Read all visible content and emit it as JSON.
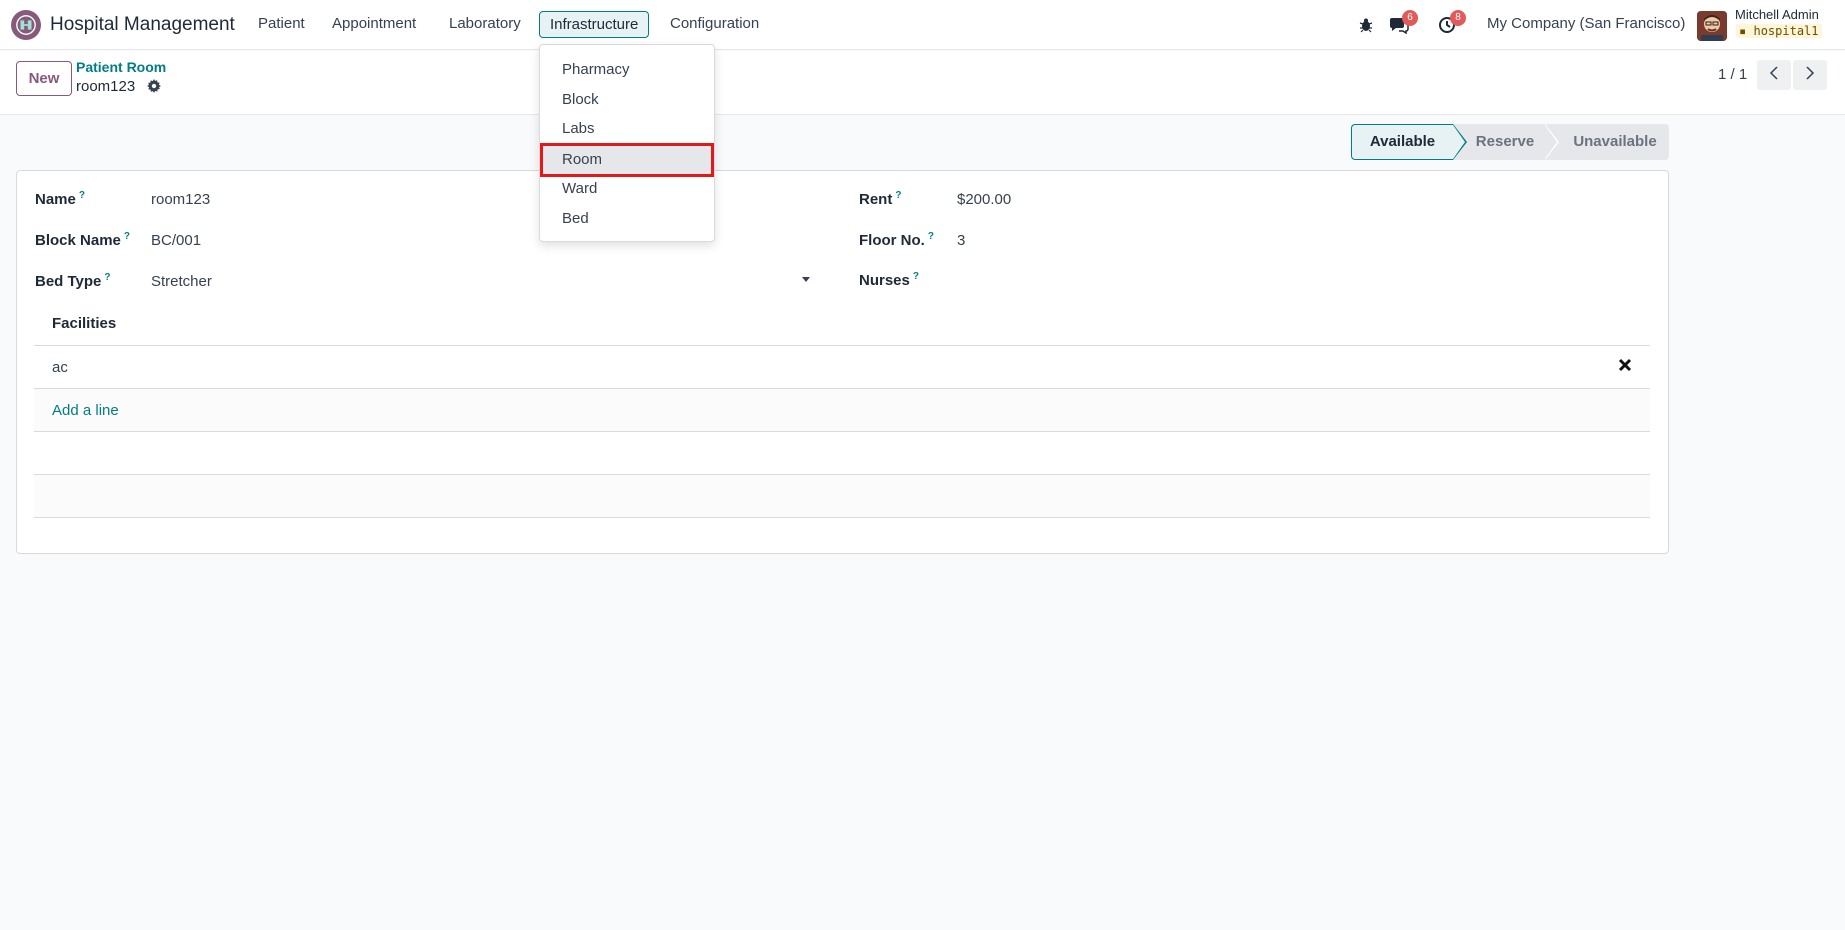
{
  "navbar": {
    "brand": "Hospital Management",
    "menus": [
      "Patient",
      "Appointment",
      "Laboratory",
      "Infrastructure",
      "Configuration"
    ],
    "active_menu": "Infrastructure",
    "messages_count": "6",
    "activities_count": "8",
    "company": "My Company (San Francisco)",
    "user_name": "Mitchell Admin",
    "db_name": "hospital1"
  },
  "infrastructure_menu": {
    "items": [
      "Pharmacy",
      "Block",
      "Labs",
      "Room",
      "Ward",
      "Bed"
    ],
    "highlighted": "Room"
  },
  "control_panel": {
    "new_label": "New",
    "breadcrumb": "Patient Room",
    "record_name": "room123",
    "pager": "1 / 1"
  },
  "status_bar": {
    "stages": [
      "Available",
      "Reserve",
      "Unavailable"
    ],
    "current": "Available"
  },
  "form": {
    "name_label": "Name",
    "name_value": "room123",
    "block_label": "Block Name",
    "block_value": "BC/001",
    "bed_type_label": "Bed Type",
    "bed_type_value": "Stretcher",
    "rent_label": "Rent",
    "rent_value": "$200.00",
    "floor_label": "Floor No.",
    "floor_value": "3",
    "nurses_label": "Nurses",
    "help_mark": "?"
  },
  "facilities": {
    "header": "Facilities",
    "rows": [
      "ac"
    ],
    "add_line": "Add a line"
  },
  "colors": {
    "primary": "#875a7b",
    "accent": "#017e84",
    "highlight_box": "#e0191b"
  }
}
